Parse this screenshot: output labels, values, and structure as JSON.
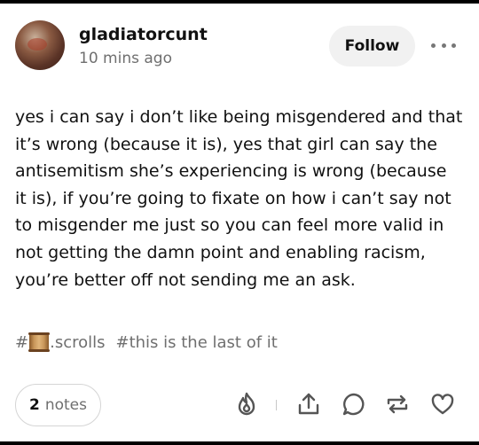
{
  "post": {
    "username": "gladiatorcunt",
    "timestamp": "10 mins ago",
    "follow_label": "Follow",
    "body": "yes i can say i don’t like being misgendered and that it’s wrong (because it is), yes that girl can say the antisemitism she’s experiencing is wrong (because it is), if you’re going to fixate on how i can’t say not to misgender me just so you can feel more valid in not getting the damn point and enabling racism, you’re better off not sending me an ask.",
    "tags": {
      "tag1_prefix": "#",
      "tag1_suffix": ".scrolls",
      "tag2": "#this is the last of it"
    },
    "notes": {
      "count": "2",
      "label": "notes"
    }
  },
  "icons": {
    "more": "more-dots-icon",
    "scroll_emoji": "scroll-emoji-icon",
    "blaze": "flame-icon",
    "share": "share-icon",
    "reply": "reply-bubble-icon",
    "reblog": "reblog-icon",
    "like": "heart-icon"
  },
  "colors": {
    "text": "#111111",
    "muted": "#6f6f6f",
    "follow_bg": "#f1f1f1",
    "frame": "#000000"
  }
}
